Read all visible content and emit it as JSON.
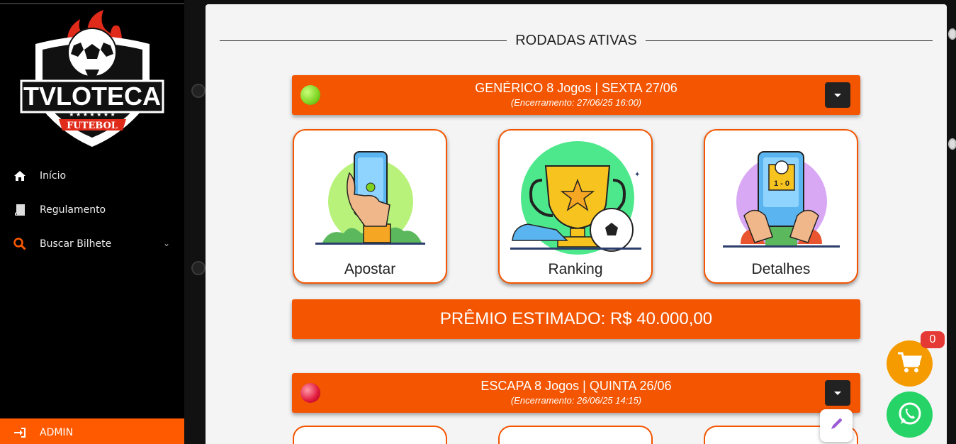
{
  "sidebar": {
    "logo_text": "TVLOTECA",
    "logo_sub": "FUTEBOL",
    "items": [
      {
        "label": "Início",
        "icon": "home-icon"
      },
      {
        "label": "Regulamento",
        "icon": "book-icon"
      },
      {
        "label": "Buscar Bilhete",
        "icon": "search-icon"
      }
    ],
    "admin_label": "ADMIN"
  },
  "main": {
    "section_title": "RODADAS ATIVAS",
    "rounds": [
      {
        "title": "GENÉRICO 8 Jogos | SEXTA 27/06",
        "closing": "(Encerramento: 27/06/25 16:00)",
        "status_color": "#7ed321"
      },
      {
        "title": "ESCAPA 8 Jogos | QUINTA 26/06",
        "closing": "(Encerramento: 26/06/25 14:15)",
        "status_color": "#e0183a"
      }
    ],
    "cards": [
      {
        "label": "Apostar"
      },
      {
        "label": "Ranking"
      },
      {
        "label": "Detalhes"
      }
    ],
    "prize": "PRÊMIO ESTIMADO: R$ 40.000,00"
  },
  "floating": {
    "cart_count": "0"
  },
  "colors": {
    "accent": "#f35500",
    "cart": "#f59b00",
    "whatsapp": "#25d366"
  }
}
